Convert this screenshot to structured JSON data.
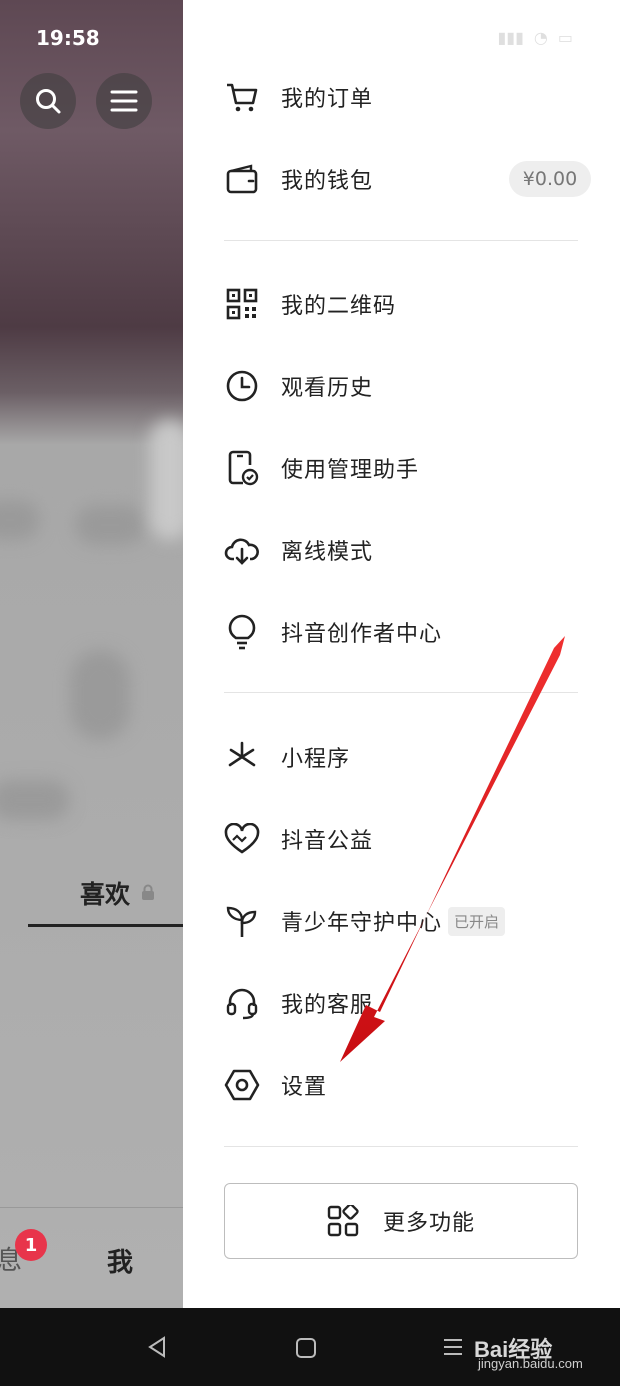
{
  "status_bar": {
    "time": "19:58"
  },
  "left_pane": {
    "tab_label": "喜欢",
    "bottom_nav": {
      "messages_fragment": "息",
      "messages_badge": "1",
      "me_label": "我"
    }
  },
  "drawer": {
    "items": [
      {
        "label": "我的订单",
        "icon": "cart-icon"
      },
      {
        "label": "我的钱包",
        "icon": "wallet-icon",
        "value": "¥0.00"
      },
      {
        "label": "我的二维码",
        "icon": "qr-code-icon"
      },
      {
        "label": "观看历史",
        "icon": "clock-icon"
      },
      {
        "label": "使用管理助手",
        "icon": "phone-check-icon"
      },
      {
        "label": "离线模式",
        "icon": "cloud-download-icon"
      },
      {
        "label": "抖音创作者中心",
        "icon": "lightbulb-icon"
      },
      {
        "label": "小程序",
        "icon": "mini-program-icon"
      },
      {
        "label": "抖音公益",
        "icon": "heart-icon"
      },
      {
        "label": "青少年守护中心",
        "icon": "sprout-icon",
        "tag": "已开启"
      },
      {
        "label": "我的客服",
        "icon": "headset-icon"
      },
      {
        "label": "设置",
        "icon": "settings-hex-icon"
      }
    ],
    "more_button": {
      "label": "更多功能",
      "icon": "apps-grid-icon"
    }
  },
  "watermark": {
    "brand": "Bai经验",
    "url": "jingyan.baidu.com"
  },
  "colors": {
    "badge": "#e8354b",
    "annotation_arrow": "#e3171c"
  }
}
